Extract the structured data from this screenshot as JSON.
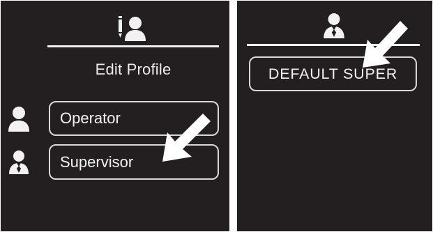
{
  "left_panel": {
    "header_icon": "edit-profile-icon",
    "title": "Edit Profile",
    "options": [
      {
        "label": "Operator",
        "icon": "operator-user-icon"
      },
      {
        "label": "Supervisor",
        "icon": "supervisor-user-icon"
      }
    ],
    "pointer": "arrow-pointing-to-supervisor"
  },
  "right_panel": {
    "header_icon": "supervisor-user-icon",
    "profiles": [
      {
        "label": "DEFAULT SUPER"
      }
    ],
    "pointer": "arrow-pointing-to-default-super"
  },
  "colors": {
    "screen_background": "#231f20",
    "foreground": "#f2f2f2",
    "page_background": "#ffffff"
  }
}
